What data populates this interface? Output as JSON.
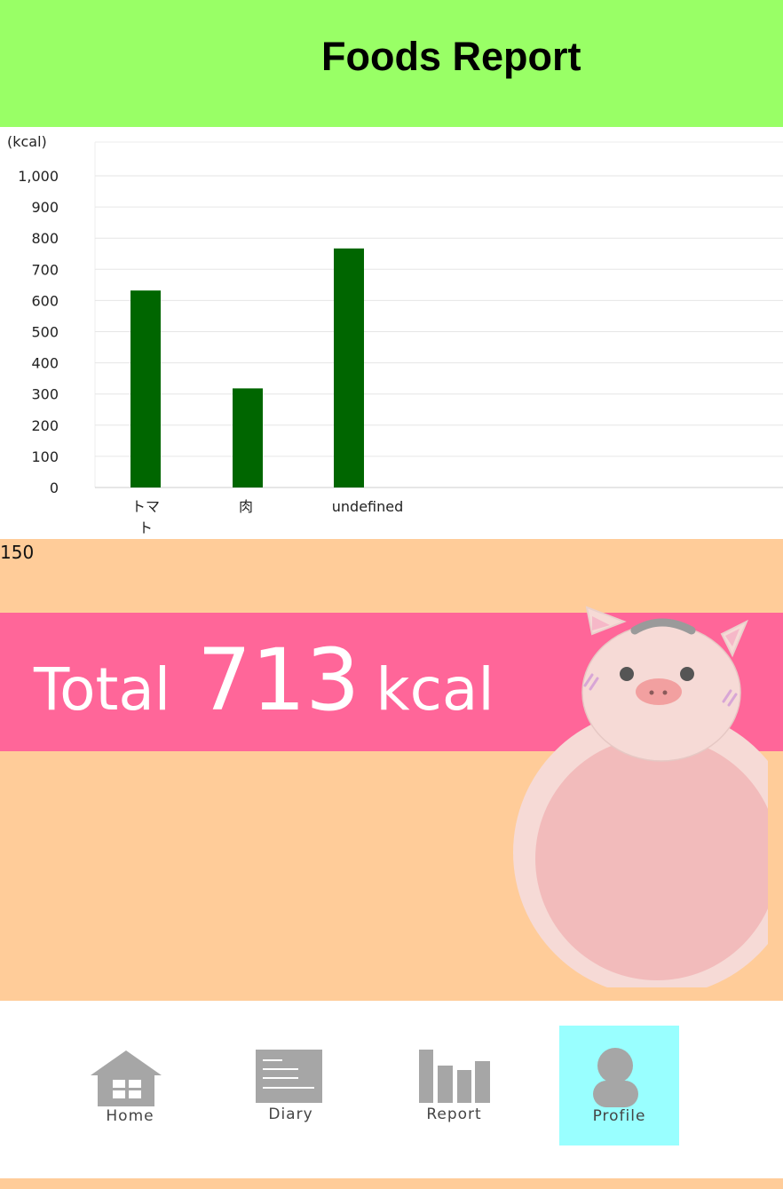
{
  "header": {
    "title": "Foods Report"
  },
  "chart_data": {
    "type": "bar",
    "ylabel": "(kcal)",
    "ylim": [
      0,
      1000
    ],
    "yticks": [
      "0",
      "100",
      "200",
      "300",
      "400",
      "500",
      "600",
      "700",
      "800",
      "900",
      "1,000"
    ],
    "categories": [
      "トマト",
      "肉",
      "undefined"
    ],
    "values": [
      632,
      318,
      767
    ],
    "bar_color": "#006600",
    "grid": true
  },
  "summary": {
    "value": "150",
    "total_label": "Total",
    "total_value": "713",
    "total_unit": "kcal"
  },
  "nav": {
    "items": [
      {
        "label": "Home",
        "icon": "home-icon",
        "active": false
      },
      {
        "label": "Diary",
        "icon": "diary-icon",
        "active": false
      },
      {
        "label": "Report",
        "icon": "report-icon",
        "active": false
      },
      {
        "label": "Profile",
        "icon": "profile-icon",
        "active": true
      }
    ]
  },
  "colors": {
    "header_bg": "#99ff66",
    "summary_bg": "#ffcc99",
    "total_band": "#ff6699",
    "nav_active": "#99ffff",
    "icon_gray": "#a6a6a6"
  }
}
